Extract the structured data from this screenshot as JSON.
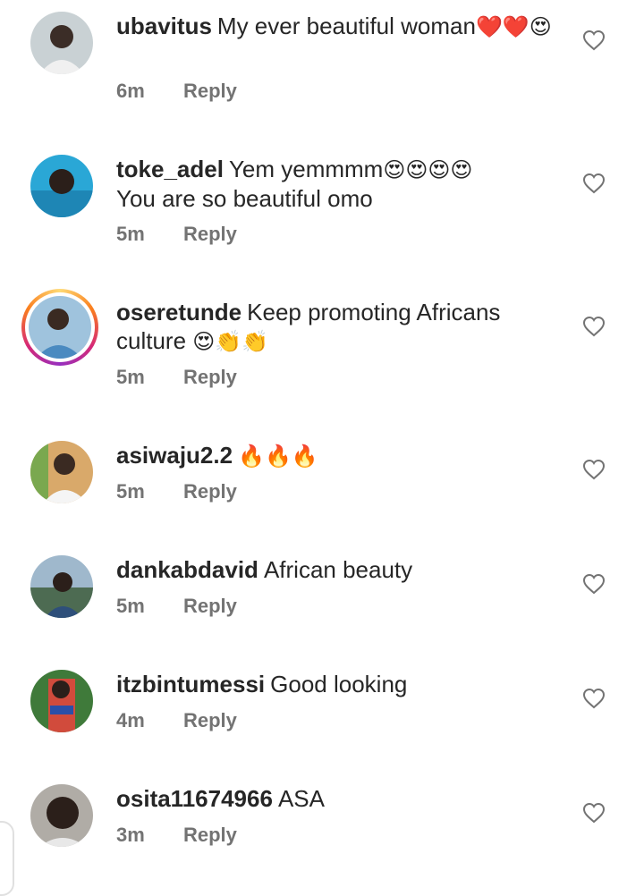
{
  "comments": [
    {
      "username": "ubavitus",
      "text": "My ever beautiful woman",
      "emoji": "❤️❤️😍",
      "time": "6m",
      "reply": "Reply",
      "avatar_color": "#b9c2c6"
    },
    {
      "username": "toke_adel",
      "text": "Yem yemmmm",
      "emoji": "😍😍😍😍",
      "text2": "You are so beautiful omo",
      "time": "5m",
      "reply": "Reply",
      "avatar_color": "#2aa7d6"
    },
    {
      "username": "oseretunde",
      "text": "Keep promoting Africans",
      "text2": "culture",
      "emoji": "😍👏👏",
      "time": "5m",
      "reply": "Reply",
      "avatar_color": "#4a8ac0"
    },
    {
      "username": "asiwaju2.2",
      "text": "",
      "emoji": "🔥🔥🔥",
      "time": "5m",
      "reply": "Reply",
      "avatar_color": "#c68c4f"
    },
    {
      "username": "dankabdavid",
      "text": "African beauty",
      "emoji": "",
      "time": "5m",
      "reply": "Reply",
      "avatar_color": "#5b7f9e"
    },
    {
      "username": "itzbintumessi",
      "text": "Good looking",
      "emoji": "",
      "time": "4m",
      "reply": "Reply",
      "avatar_color": "#d14b3c"
    },
    {
      "username": "osita11674966",
      "text": "ASA",
      "emoji": "",
      "time": "3m",
      "reply": "Reply",
      "avatar_color": "#9a9a94"
    }
  ],
  "icons": {
    "like": "heart-outline-icon"
  }
}
